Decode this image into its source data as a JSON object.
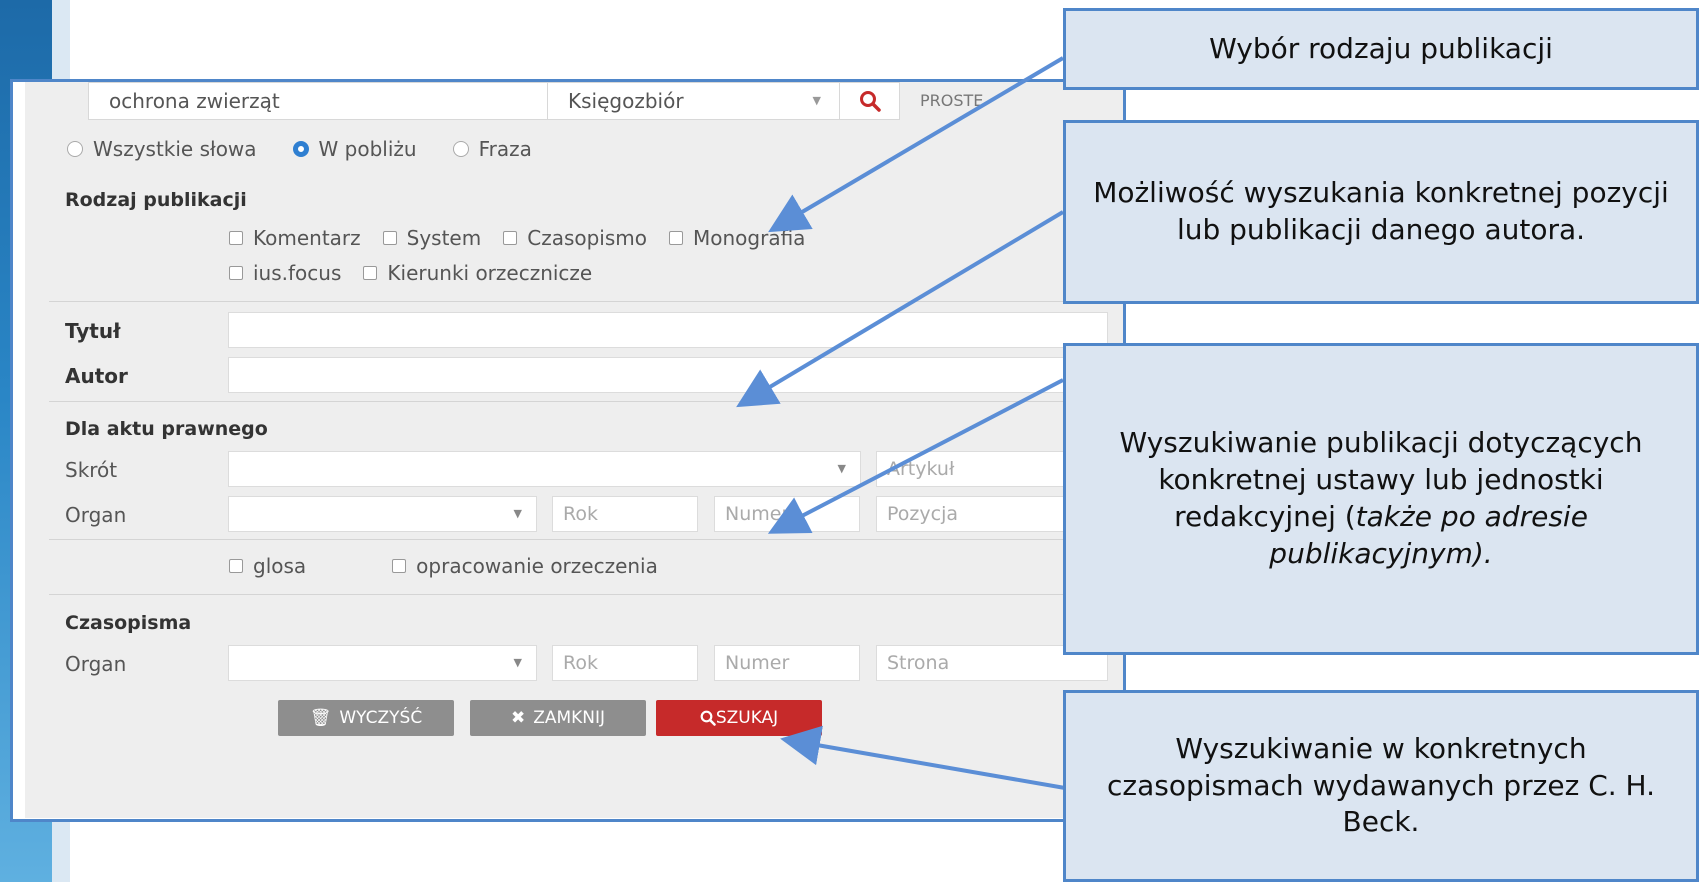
{
  "search": {
    "query": "ochrona zwierząt",
    "collection": "Księgozbiór",
    "mode": "PROSTE"
  },
  "match_options": [
    {
      "label": "Wszystkie słowa",
      "checked": false
    },
    {
      "label": "W pobliżu",
      "checked": true
    },
    {
      "label": "Fraza",
      "checked": false
    }
  ],
  "publication_type": {
    "heading": "Rodzaj publikacji",
    "options_row1": [
      "Komentarz",
      "System",
      "Czasopismo",
      "Monografia"
    ],
    "options_row2": [
      "ius.focus",
      "Kierunki orzecznicze"
    ]
  },
  "title_field": {
    "label": "Tytuł",
    "value": ""
  },
  "author_field": {
    "label": "Autor",
    "value": ""
  },
  "legal_act": {
    "heading": "Dla aktu prawnego",
    "skrot_label": "Skrót",
    "artykul_placeholder": "Artykuł",
    "organ_label": "Organ",
    "rok_placeholder": "Rok",
    "numer_placeholder": "Numer",
    "pozycja_placeholder": "Pozycja",
    "checkbox_glosa": "glosa",
    "checkbox_opracowanie": "opracowanie orzeczenia"
  },
  "journals": {
    "heading": "Czasopisma",
    "organ_label": "Organ",
    "rok_placeholder": "Rok",
    "numer_placeholder": "Numer",
    "strona_placeholder": "Strona"
  },
  "buttons": {
    "clear": "WYCZYŚĆ",
    "close": "ZAMKNIJ",
    "search": "SZUKAJ"
  },
  "callouts": {
    "c1": "Wybór rodzaju publikacji",
    "c2": "Możliwość wyszukania konkretnej pozycji lub publikacji danego autora.",
    "c3_main": "Wyszukiwanie publikacji dotyczących konkretnej ustawy lub jednostki redakcyjnej (",
    "c3_italic": "także po adresie publikacyjnym).",
    "c4": "Wyszukiwanie w konkretnych czasopismach wydawanych przez C. H. Beck."
  },
  "colors": {
    "accent_blue": "#4f86c9",
    "callout_bg": "#dbe5f1",
    "search_red": "#c62a2a",
    "button_grey": "#8e8e8e",
    "radio_blue": "#2f7fd1"
  },
  "icons": [
    "search-icon",
    "trash-icon",
    "close-icon",
    "chevron-down-icon"
  ]
}
